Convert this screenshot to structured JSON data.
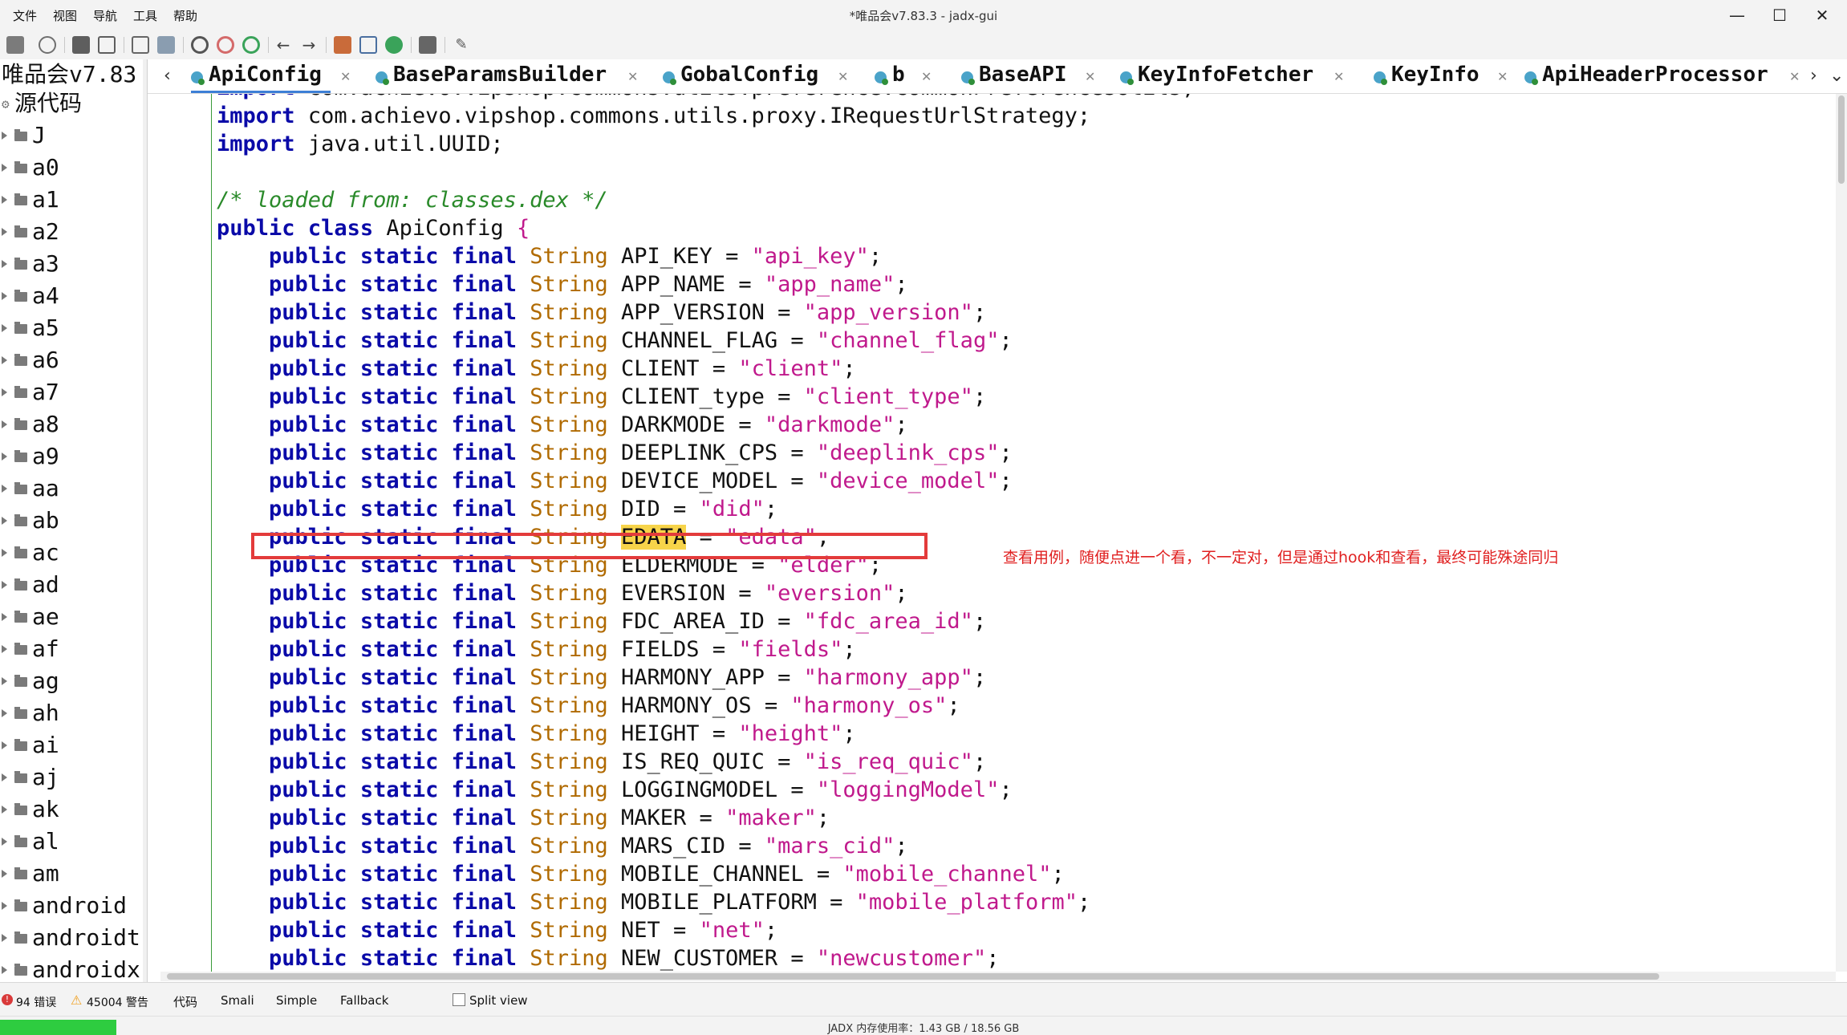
{
  "window": {
    "title": "*唯品会v7.83.3 - jadx-gui",
    "menu": [
      "文件",
      "视图",
      "导航",
      "工具",
      "帮助"
    ],
    "controls": [
      "—",
      "☐",
      "✕"
    ]
  },
  "tree": {
    "root_label": "唯品会v7.83",
    "source_label": "源代码",
    "items": [
      "J",
      "a0",
      "a1",
      "a2",
      "a3",
      "a4",
      "a5",
      "a6",
      "a7",
      "a8",
      "a9",
      "aa",
      "ab",
      "ac",
      "ad",
      "ae",
      "af",
      "ag",
      "ah",
      "ai",
      "aj",
      "ak",
      "al",
      "am",
      "android",
      "androidt",
      "androidx"
    ]
  },
  "tabs": [
    {
      "label": "ApiConfig",
      "active": true
    },
    {
      "label": "BaseParamsBuilder",
      "active": false
    },
    {
      "label": "GobalConfig",
      "active": false
    },
    {
      "label": "b",
      "active": false
    },
    {
      "label": "BaseAPI",
      "active": false
    },
    {
      "label": "KeyInfoFetcher",
      "active": false
    },
    {
      "label": "KeyInfo",
      "active": false
    },
    {
      "label": "ApiHeaderProcessor",
      "active": false
    }
  ],
  "code": {
    "imports": [
      "com.achievo.vipshop.commons.utils.preference.CommonPreferencesUtils;",
      "com.achievo.vipshop.commons.utils.proxy.IRequestUrlStrategy;",
      "java.util.UUID;"
    ],
    "import_kw": "import",
    "comment": "/* loaded from: classes.dex */",
    "class_decl": {
      "kw1": "public",
      "kw2": "class",
      "name": "ApiConfig",
      "brace": "{"
    },
    "field_prefix": {
      "kw1": "public",
      "kw2": "static",
      "kw3": "final",
      "type": "String"
    },
    "fields": [
      {
        "name": "API_KEY",
        "value": "\"api_key\""
      },
      {
        "name": "APP_NAME",
        "value": "\"app_name\""
      },
      {
        "name": "APP_VERSION",
        "value": "\"app_version\""
      },
      {
        "name": "CHANNEL_FLAG",
        "value": "\"channel_flag\""
      },
      {
        "name": "CLIENT",
        "value": "\"client\""
      },
      {
        "name": "CLIENT_type",
        "value": "\"client_type\""
      },
      {
        "name": "DARKMODE",
        "value": "\"darkmode\""
      },
      {
        "name": "DEEPLINK_CPS",
        "value": "\"deeplink_cps\""
      },
      {
        "name": "DEVICE_MODEL",
        "value": "\"device_model\""
      },
      {
        "name": "DID",
        "value": "\"did\""
      },
      {
        "name": "EDATA",
        "value": "\"edata\"",
        "highlighted": true
      },
      {
        "name": "ELDERMODE",
        "value": "\"elder\""
      },
      {
        "name": "EVERSION",
        "value": "\"eversion\""
      },
      {
        "name": "FDC_AREA_ID",
        "value": "\"fdc_area_id\""
      },
      {
        "name": "FIELDS",
        "value": "\"fields\""
      },
      {
        "name": "HARMONY_APP",
        "value": "\"harmony_app\""
      },
      {
        "name": "HARMONY_OS",
        "value": "\"harmony_os\""
      },
      {
        "name": "HEIGHT",
        "value": "\"height\""
      },
      {
        "name": "IS_REQ_QUIC",
        "value": "\"is_req_quic\""
      },
      {
        "name": "LOGGINGMODEL",
        "value": "\"loggingModel\""
      },
      {
        "name": "MAKER",
        "value": "\"maker\""
      },
      {
        "name": "MARS_CID",
        "value": "\"mars_cid\""
      },
      {
        "name": "MOBILE_CHANNEL",
        "value": "\"mobile_channel\""
      },
      {
        "name": "MOBILE_PLATFORM",
        "value": "\"mobile_platform\""
      },
      {
        "name": "NET",
        "value": "\"net\""
      },
      {
        "name": "NEW_CUSTOMER",
        "value": "\"newcustomer\""
      }
    ],
    "annotation": "查看用例，随便点进一个看，不一定对，但是通过hook和查看，最终可能殊途同归"
  },
  "bottom": {
    "errors": "94 错误",
    "warnings": "45004 警告",
    "tabs": [
      "代码",
      "Smali",
      "Simple",
      "Fallback"
    ],
    "split_view": "Split view",
    "memory": "JADX 内存使用率：1.43 GB / 18.56 GB",
    "memory_fraction": 0.077
  },
  "colors": {
    "keyword": "#0a0aa8",
    "type": "#b06a00",
    "string": "#c0198c",
    "comment": "#2a8a2a",
    "annotation": "#e02020",
    "highlight_box": "#e33b3b",
    "memory_bar": "#2ecc40"
  }
}
